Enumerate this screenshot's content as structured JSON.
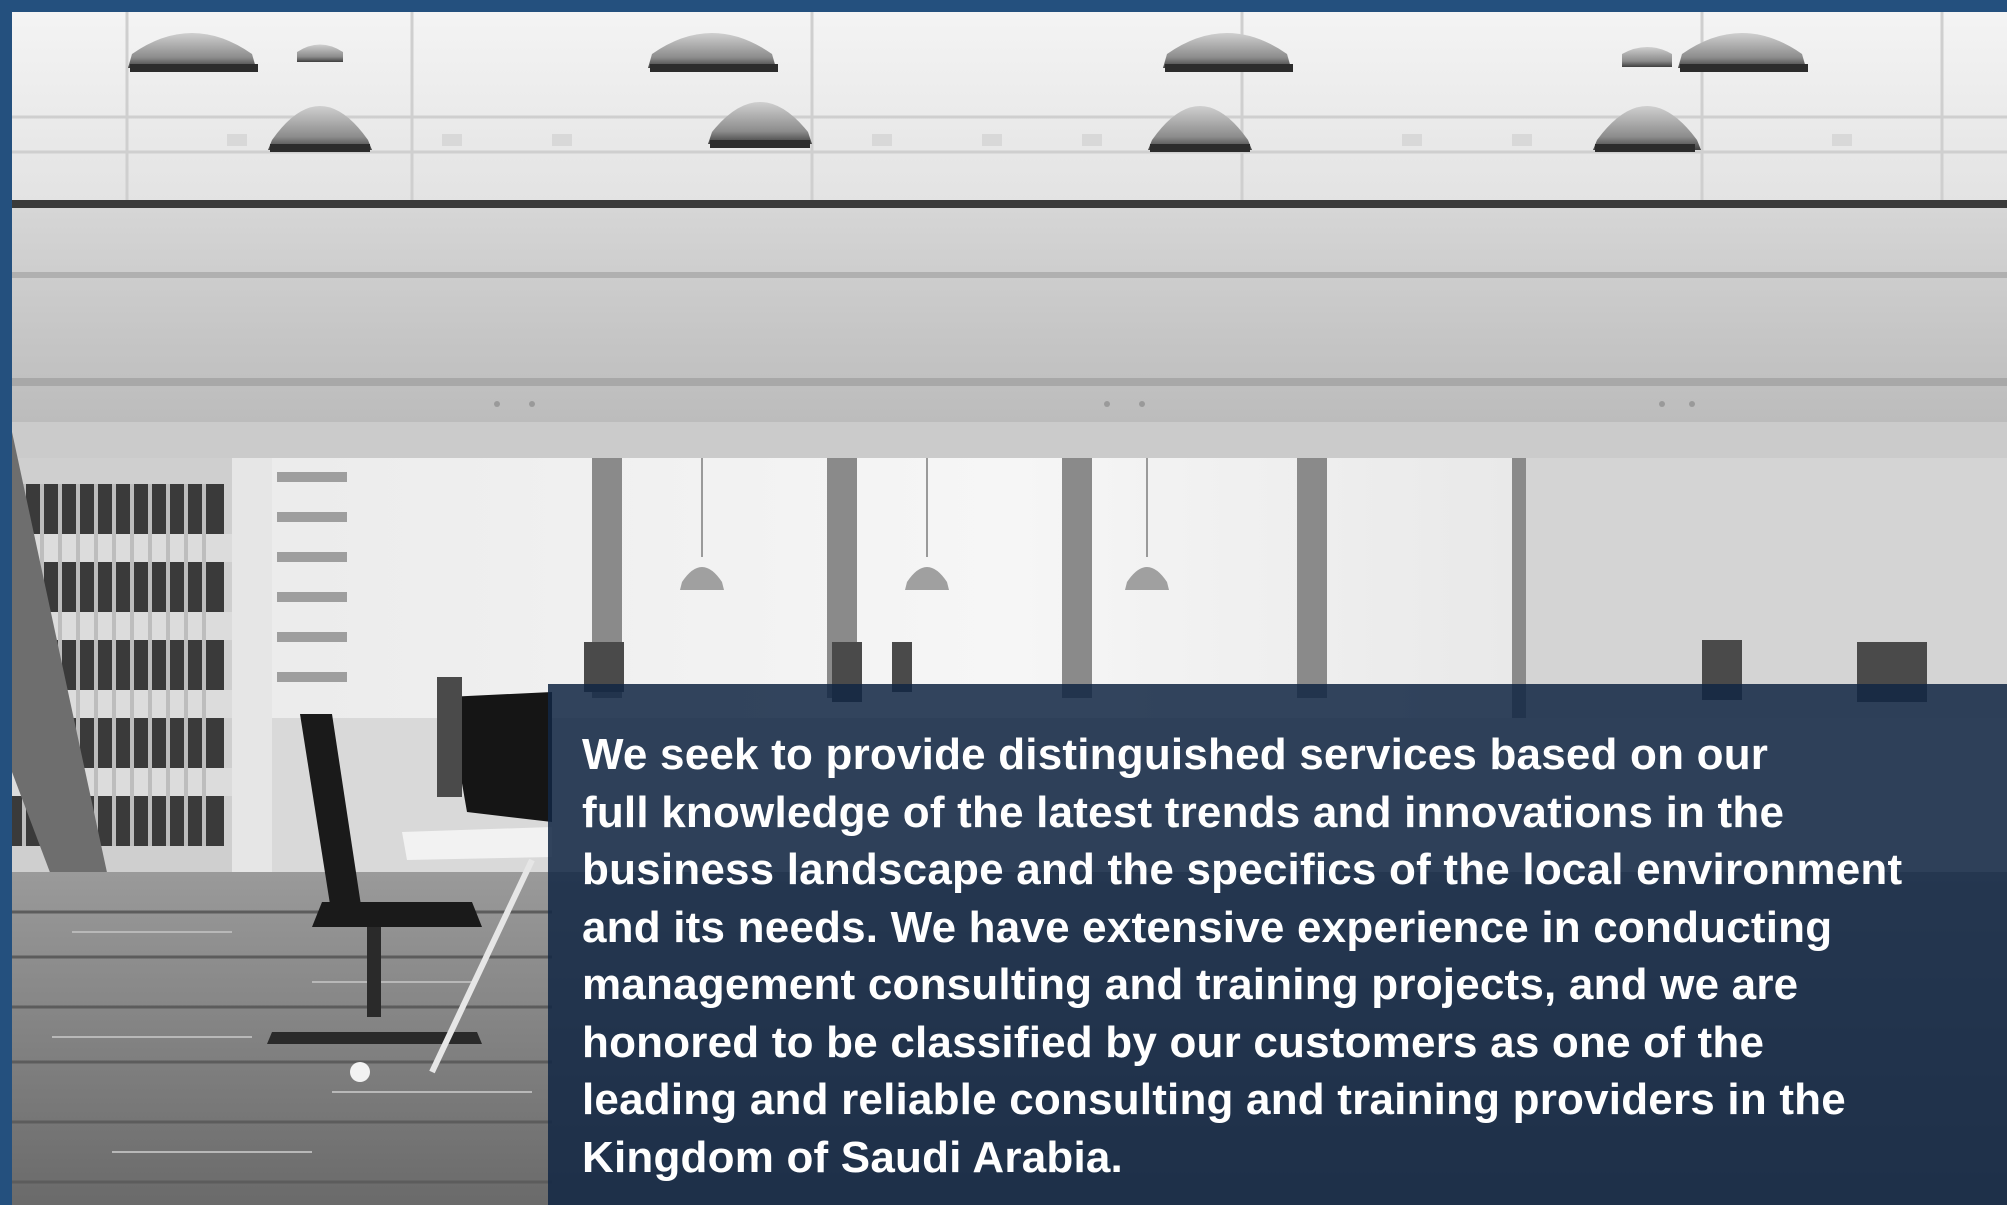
{
  "hero": {
    "image_description_icon": "office-interior-photo",
    "caption_lines": [
      "We seek to provide distinguished services based on our",
      "full knowledge of the latest trends and innovations in the",
      "business landscape and the specifics of the local environment",
      "and its needs. We have extensive experience in conducting",
      "management consulting and training projects, and we are",
      "honored to be classified by our customers as one of the",
      "leading and reliable consulting and training providers in the",
      "Kingdom of Saudi Arabia."
    ]
  },
  "colors": {
    "frame_border": "#24507e",
    "panel_bg": "#112644",
    "text": "#ffffff"
  }
}
